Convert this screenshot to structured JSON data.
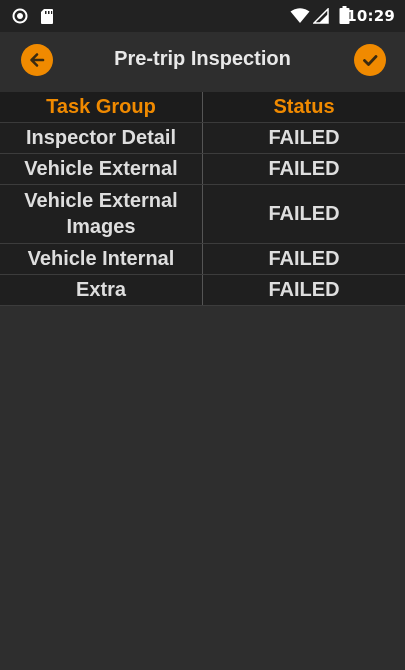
{
  "status_bar": {
    "left_icons": [
      "circle-icon",
      "sd-card-icon"
    ],
    "right_icons": [
      "wifi-icon",
      "signal-icon",
      "battery-icon"
    ],
    "time": "10:29"
  },
  "header": {
    "title": "Pre-trip Inspection",
    "back_icon": "arrow-left-icon",
    "confirm_icon": "checkmark-icon",
    "accent_color": "#f08a00"
  },
  "table": {
    "columns": [
      "Task Group",
      "Status"
    ],
    "rows": [
      {
        "task": "Inspector Detail",
        "status": "FAILED"
      },
      {
        "task": "Vehicle External",
        "status": "FAILED"
      },
      {
        "task": "Vehicle External Images",
        "status": "FAILED"
      },
      {
        "task": "Vehicle Internal",
        "status": "FAILED"
      },
      {
        "task": "Extra",
        "status": "FAILED"
      }
    ]
  }
}
